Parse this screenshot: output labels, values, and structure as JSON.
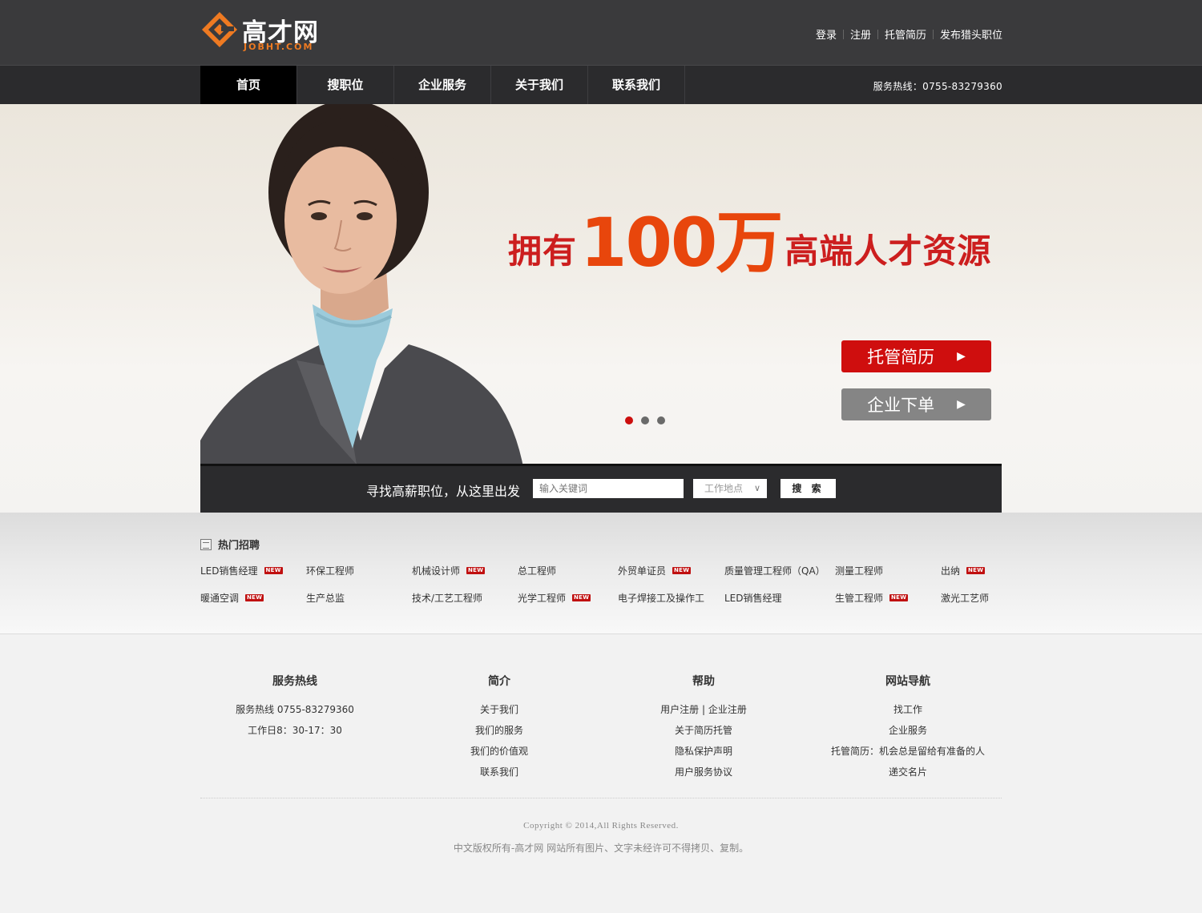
{
  "header": {
    "logo_name": "高才网",
    "logo_sub": "JOBHT.COM",
    "links": [
      "登录",
      "注册",
      "托管简历",
      "发布猎头职位"
    ]
  },
  "nav": {
    "items": [
      "首页",
      "搜职位",
      "企业服务",
      "关于我们",
      "联系我们"
    ],
    "hotline": "服务热线：0755-83279360"
  },
  "banner": {
    "slogan_prefix": "拥有",
    "slogan_number": "100万",
    "slogan_suffix": "高端人才资源",
    "btn_resume": "托管简历",
    "btn_order": "企业下单",
    "slides_total": 3,
    "slide_active": 1
  },
  "search": {
    "label": "寻找高薪职位，从这里出发",
    "keyword_placeholder": "输入关键词",
    "location": "工作地点",
    "button": "搜 索"
  },
  "hot": {
    "title": "热门招聘",
    "new_label": "NEW",
    "rows": [
      [
        {
          "name": "LED销售经理",
          "new": true
        },
        {
          "name": "环保工程师",
          "new": false
        },
        {
          "name": "机械设计师",
          "new": true
        },
        {
          "name": "总工程师",
          "new": false
        },
        {
          "name": "外贸单证员",
          "new": true
        },
        {
          "name": "质量管理工程师（QA）",
          "new": false
        },
        {
          "name": "测量工程师",
          "new": false
        },
        {
          "name": "出纳",
          "new": true
        }
      ],
      [
        {
          "name": "暖通空调",
          "new": true
        },
        {
          "name": "生产总监",
          "new": false
        },
        {
          "name": "技术/工艺工程师",
          "new": false
        },
        {
          "name": "光学工程师",
          "new": true
        },
        {
          "name": "电子焊接工及操作工",
          "new": false
        },
        {
          "name": "LED销售经理",
          "new": false
        },
        {
          "name": "生管工程师",
          "new": true
        },
        {
          "name": "激光工艺师",
          "new": false
        }
      ]
    ]
  },
  "footer": {
    "cols": [
      {
        "title": "服务热线",
        "lines": [
          "服务热线 0755-83279360",
          "工作日8：30-17：30"
        ]
      },
      {
        "title": "简介",
        "lines": [
          "关于我们",
          "我们的服务",
          "我们的价值观",
          "联系我们"
        ]
      },
      {
        "title": "帮助",
        "lines": [
          "用户注册 | 企业注册",
          "关于简历托管",
          "隐私保护声明",
          "用户服务协议"
        ]
      },
      {
        "title": "网站导航",
        "lines": [
          "找工作",
          "企业服务",
          "托管简历：机会总是留给有准备的人",
          "递交名片"
        ]
      }
    ],
    "copyright": "Copyright © 2014,All Rights Reserved.",
    "notice": "中文版权所有-高才网 网站所有图片、文字未经许可不得拷贝、复制。"
  },
  "colors": {
    "header_bg": "#3a3a3c",
    "nav_bg": "#2b2b2d",
    "accent_red": "#cf0e0e",
    "accent_orange": "#e8460c"
  }
}
